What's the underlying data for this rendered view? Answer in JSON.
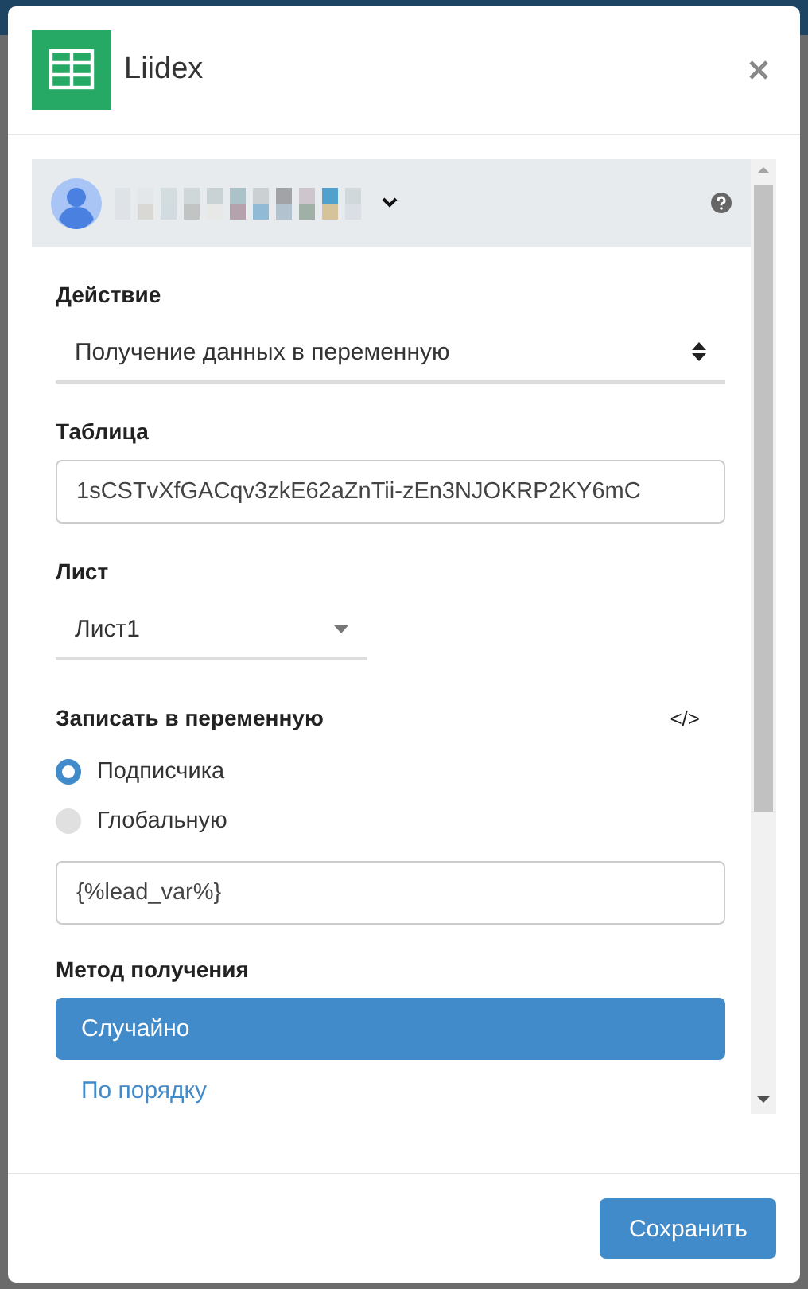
{
  "dialog": {
    "title": "Liidex"
  },
  "fields": [
    {
      "kind": "select",
      "label": "Действие",
      "value": "Получение данных в переменную"
    },
    {
      "kind": "input",
      "label": "Таблица",
      "value": "1sCSTvXfGACqv3zkE62aZnTii-zEn3NJOKRP2KY6mC"
    },
    {
      "kind": "dropdown",
      "label": "Лист",
      "value": "Лист1"
    }
  ],
  "variable": {
    "label": "Записать в переменную",
    "code_toggle": "</>",
    "scopes": [
      {
        "label": "Подписчика",
        "selected": true
      },
      {
        "label": "Глобальную",
        "selected": false
      }
    ],
    "value": "{%lead_var%}"
  },
  "method": {
    "label": "Метод получения",
    "options": [
      {
        "label": "Случайно",
        "selected": true
      },
      {
        "label": "По порядку",
        "selected": false
      }
    ]
  },
  "footer": {
    "save": "Сохранить"
  }
}
